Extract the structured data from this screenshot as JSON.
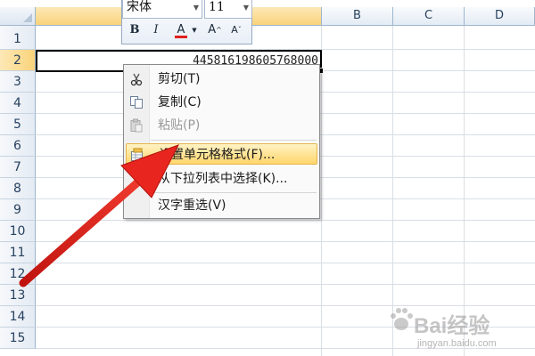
{
  "columns": [
    {
      "label": "",
      "selected": true
    },
    {
      "label": "B",
      "selected": false
    },
    {
      "label": "C",
      "selected": false
    },
    {
      "label": "D",
      "selected": false
    }
  ],
  "rows": [
    "1",
    "2",
    "3",
    "4",
    "5",
    "6",
    "7",
    "8",
    "9",
    "10",
    "11",
    "12",
    "13",
    "14",
    "15"
  ],
  "selected_row": "2",
  "active_cell": {
    "value": "445816198605768000"
  },
  "mini_toolbar": {
    "font_name": "宋体",
    "font_size": "11",
    "bold_label": "B",
    "italic_label": "I",
    "font_color_label": "A",
    "grow_font_label": "A",
    "shrink_font_label": "A",
    "font_color": "#e0201c"
  },
  "context_menu": {
    "items": [
      {
        "label": "剪切(T)",
        "icon": "scissors-icon",
        "disabled": false
      },
      {
        "label": "复制(C)",
        "icon": "copy-icon",
        "disabled": false
      },
      {
        "label": "粘贴(P)",
        "icon": "paste-icon",
        "disabled": true
      },
      {
        "label": "设置单元格格式(F)...",
        "icon": "format-cells-icon",
        "disabled": false,
        "highlighted": true
      },
      {
        "label": "从下拉列表中选择(K)...",
        "icon": "",
        "disabled": false
      },
      {
        "label": "汉字重选(V)",
        "icon": "",
        "disabled": false
      }
    ]
  },
  "annotation": {
    "color": "#e8261f"
  },
  "watermark": {
    "brand": "Bai经验",
    "url": "jingyan.baidu.com"
  }
}
